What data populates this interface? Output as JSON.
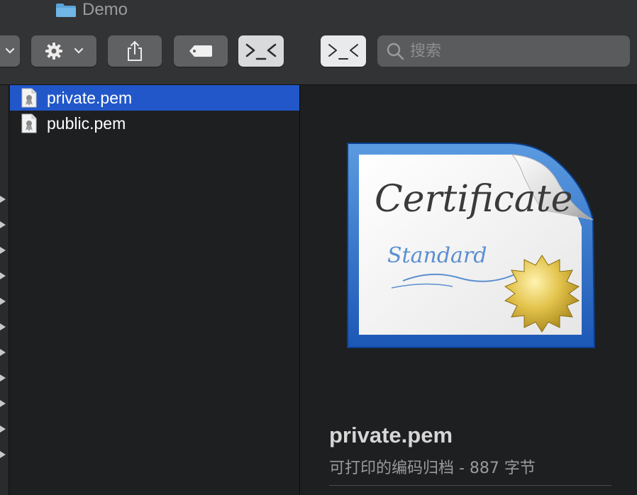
{
  "window": {
    "title": "Demo"
  },
  "toolbar": {
    "buttons": [
      {
        "name": "back-chevron",
        "icon": "chevron-down-icon"
      },
      {
        "name": "action",
        "icon": "gear-icon"
      },
      {
        "name": "share",
        "icon": "share-icon"
      },
      {
        "name": "tags",
        "icon": "tag-icon"
      },
      {
        "name": "terminal",
        "icon": "terminal-icon"
      },
      {
        "name": "terminal-alt",
        "icon": "terminal-icon"
      }
    ],
    "search": {
      "placeholder": "搜索",
      "value": ""
    }
  },
  "files": [
    {
      "name": "private.pem",
      "selected": true,
      "icon": "certificate-file-icon"
    },
    {
      "name": "public.pem",
      "selected": false,
      "icon": "certificate-file-icon"
    }
  ],
  "preview": {
    "file_name": "private.pem",
    "info": "可打印的编码归档 - 887 字节",
    "image_text": {
      "title": "Certificate",
      "subtitle": "Standard"
    }
  },
  "colors": {
    "selection": "#2157c9",
    "background": "#1e1f21",
    "toolbar": "#323335"
  }
}
